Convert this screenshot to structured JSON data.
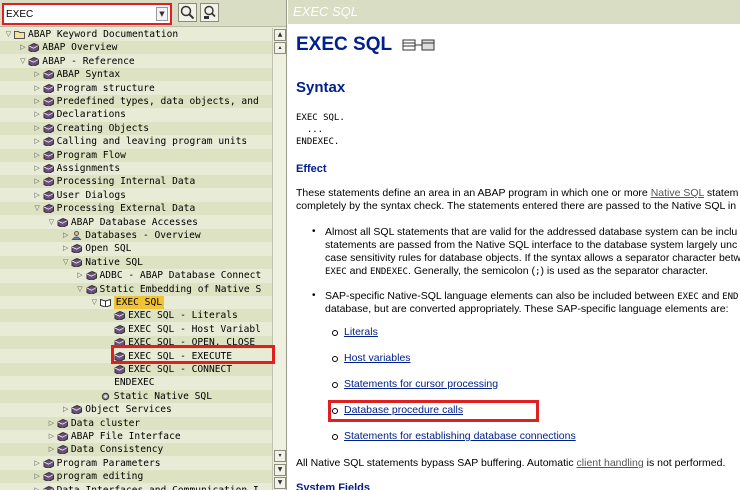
{
  "search": {
    "value": "EXEC",
    "dropdown_icon": "chevron-down-icon"
  },
  "toolbar": {
    "find_icon": "magnifier-icon",
    "find_next_icon": "magnifier-next-icon"
  },
  "tree": [
    {
      "label": "ABAP Keyword Documentation",
      "indent": 0,
      "arrow": "down",
      "icon": "folder-open-icon"
    },
    {
      "label": "ABAP Overview",
      "indent": 1,
      "arrow": "right",
      "icon": "book-icon"
    },
    {
      "label": "ABAP - Reference",
      "indent": 1,
      "arrow": "down",
      "icon": "book-icon"
    },
    {
      "label": "ABAP Syntax",
      "indent": 2,
      "arrow": "right",
      "icon": "book-icon"
    },
    {
      "label": "Program structure",
      "indent": 2,
      "arrow": "right",
      "icon": "book-icon"
    },
    {
      "label": "Predefined types, data objects, and",
      "indent": 2,
      "arrow": "right",
      "icon": "book-icon"
    },
    {
      "label": "Declarations",
      "indent": 2,
      "arrow": "right",
      "icon": "book-icon"
    },
    {
      "label": "Creating Objects",
      "indent": 2,
      "arrow": "right",
      "icon": "book-icon"
    },
    {
      "label": "Calling and leaving program units",
      "indent": 2,
      "arrow": "right",
      "icon": "book-icon"
    },
    {
      "label": "Program Flow",
      "indent": 2,
      "arrow": "right",
      "icon": "book-icon"
    },
    {
      "label": "Assignments",
      "indent": 2,
      "arrow": "right",
      "icon": "book-icon"
    },
    {
      "label": "Processing Internal Data",
      "indent": 2,
      "arrow": "right",
      "icon": "book-icon"
    },
    {
      "label": "User Dialogs",
      "indent": 2,
      "arrow": "right",
      "icon": "book-icon"
    },
    {
      "label": "Processing External Data",
      "indent": 2,
      "arrow": "down",
      "icon": "book-icon"
    },
    {
      "label": "ABAP Database Accesses",
      "indent": 3,
      "arrow": "down",
      "icon": "book-icon"
    },
    {
      "label": "Databases - Overview",
      "indent": 4,
      "arrow": "right",
      "icon": "person-icon"
    },
    {
      "label": "Open SQL",
      "indent": 4,
      "arrow": "right",
      "icon": "book-icon"
    },
    {
      "label": "Native SQL",
      "indent": 4,
      "arrow": "down",
      "icon": "book-icon"
    },
    {
      "label": "ADBC - ABAP Database Connect",
      "indent": 5,
      "arrow": "right",
      "icon": "book-icon"
    },
    {
      "label": "Static Embedding of Native S",
      "indent": 5,
      "arrow": "down",
      "icon": "book-icon"
    },
    {
      "label": "EXEC SQL",
      "indent": 6,
      "arrow": "down",
      "icon": "book-open-icon",
      "selected": true
    },
    {
      "label": "EXEC SQL - Literals",
      "indent": 7,
      "arrow": "",
      "icon": "book-icon"
    },
    {
      "label": "EXEC SQL - Host Variabl",
      "indent": 7,
      "arrow": "",
      "icon": "book-icon"
    },
    {
      "label": "EXEC SQL - OPEN, CLOSE",
      "indent": 7,
      "arrow": "",
      "icon": "book-icon"
    },
    {
      "label": "EXEC SQL - EXECUTE",
      "indent": 7,
      "arrow": "",
      "icon": "book-icon"
    },
    {
      "label": "EXEC SQL - CONNECT",
      "indent": 7,
      "arrow": "",
      "icon": "book-icon"
    },
    {
      "label": "ENDEXEC",
      "indent": 7,
      "arrow": "",
      "icon": "none"
    },
    {
      "label": "Static Native SQL",
      "indent": 6,
      "arrow": "",
      "icon": "gear-icon"
    },
    {
      "label": "Object Services",
      "indent": 4,
      "arrow": "right",
      "icon": "book-icon"
    },
    {
      "label": "Data cluster",
      "indent": 3,
      "arrow": "right",
      "icon": "book-icon"
    },
    {
      "label": "ABAP File Interface",
      "indent": 3,
      "arrow": "right",
      "icon": "book-icon"
    },
    {
      "label": "Data Consistency",
      "indent": 3,
      "arrow": "right",
      "icon": "book-icon"
    },
    {
      "label": "Program Parameters",
      "indent": 2,
      "arrow": "right",
      "icon": "book-icon"
    },
    {
      "label": "program editing",
      "indent": 2,
      "arrow": "right",
      "icon": "book-icon"
    },
    {
      "label": "Data Interfaces and Communication I",
      "indent": 2,
      "arrow": "right",
      "icon": "book-icon"
    }
  ],
  "doc": {
    "header_title": "EXEC SQL",
    "title": "EXEC SQL",
    "title_icon": "database-table-icon",
    "syntax_heading": "Syntax",
    "syntax_lines": [
      "EXEC SQL.",
      "  ...",
      "ENDEXEC."
    ],
    "effect_heading": "Effect",
    "effect_line1_pre": "These statements define an area in an ABAP program in which one or more ",
    "effect_link": "Native SQL",
    "effect_line1_post": " statem",
    "effect_line2": "completely by the syntax check. The statements entered there are passed to the Native SQL in",
    "bullet1_line1": "Almost all SQL statements that are valid for the addressed database system can be inclu",
    "bullet1_line2": "statements are passed from the Native SQL interface to the database system largely unc",
    "bullet1_line3": "case sensitivity rules for database objects. If the syntax allows a separator character betw",
    "bullet1_line4_kw1": "EXEC",
    "bullet1_line4_and": " and ",
    "bullet1_line4_kw2": "ENDEXEC",
    "bullet1_line4_post": ". Generally, the semicolon (",
    "bullet1_line4_semi": ";",
    "bullet1_line4_end": ") is used as the separator character.",
    "bullet2_line1_pre": "SAP-specific Native-SQL language elements can also be included between ",
    "bullet2_line1_kw1": "EXEC",
    "bullet2_line1_and": " and ",
    "bullet2_line1_kw2": "END",
    "bullet2_line2": "database, but are converted appropriately. These SAP-specific language elements are:",
    "sublinks": [
      "Literals",
      "Host variables",
      "Statements for cursor processing",
      "Database procedure calls",
      "Statements for establishing database connections"
    ],
    "footer_pre": "All Native SQL statements bypass SAP buffering. Automatic ",
    "footer_link": "client handling",
    "footer_post": " is not performed.",
    "system_fields_heading": "System Fields"
  },
  "colors": {
    "accent_red": "#e02020",
    "link_blue": "#00218c",
    "selection": "#f1c232",
    "tree_bg": "#e8ecd6"
  }
}
